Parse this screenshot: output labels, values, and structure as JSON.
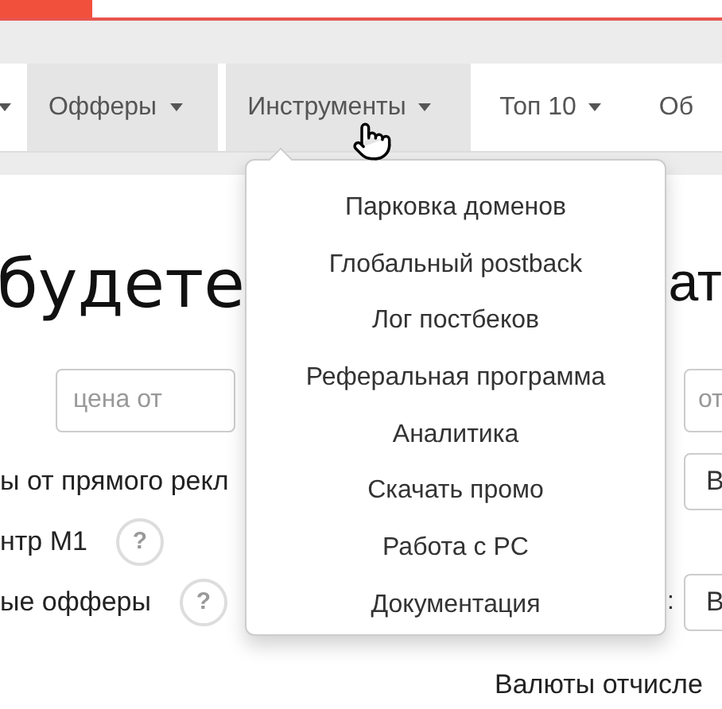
{
  "nav": {
    "items": [
      {
        "highlighted": false
      },
      {
        "label": "Офферы",
        "highlighted": true
      },
      {
        "label": "Инструменты",
        "highlighted": true
      },
      {
        "label": "Топ 10",
        "highlighted": false
      },
      {
        "label": "Об",
        "highlighted": false
      }
    ]
  },
  "dropdown": {
    "items": [
      "Парковка доменов",
      "Глобальный postback",
      "Лог постбеков",
      "Реферальная программа",
      "Аналитика",
      "Скачать промо",
      "Работа с PC",
      "Документация"
    ]
  },
  "content": {
    "heading_left": "будете",
    "heading_right": "ат",
    "price_field": {
      "placeholder": "цена от"
    },
    "right_field": {
      "placeholder": "от"
    },
    "rows": [
      {
        "label": "ы от прямого рекл",
        "box": "В"
      },
      {
        "label": "нтр M1",
        "help": true,
        "help_text": "?",
        "box": ""
      },
      {
        "label": "ые офферы",
        "help": true,
        "help_text": "?",
        "box": "В",
        "suffix": ":"
      }
    ],
    "footer": "Валюты отчисле"
  }
}
